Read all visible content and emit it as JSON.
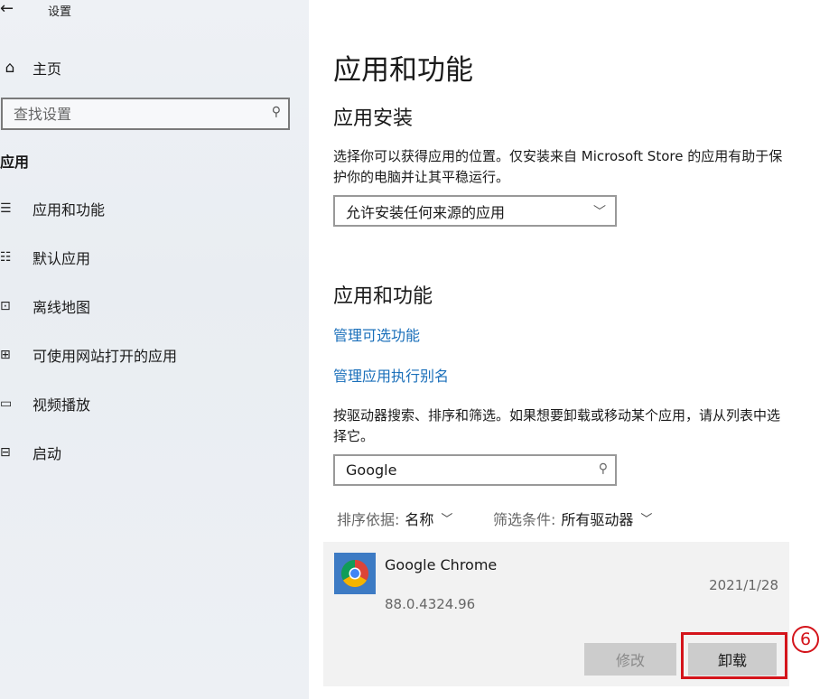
{
  "window": {
    "title": "设置",
    "back_glyph": "←"
  },
  "sidebar": {
    "home_label": "主页",
    "search_placeholder": "查找设置",
    "section_title": "应用",
    "items": [
      {
        "label": "应用和功能",
        "icon": "apps-features-icon",
        "glyph": "☰"
      },
      {
        "label": "默认应用",
        "icon": "default-apps-icon",
        "glyph": "☷"
      },
      {
        "label": "离线地图",
        "icon": "offline-maps-icon",
        "glyph": "⊡"
      },
      {
        "label": "可使用网站打开的应用",
        "icon": "apps-for-websites-icon",
        "glyph": "⊞"
      },
      {
        "label": "视频播放",
        "icon": "video-playback-icon",
        "glyph": "▭"
      },
      {
        "label": "启动",
        "icon": "startup-icon",
        "glyph": "⊟"
      }
    ]
  },
  "main": {
    "title": "应用和功能",
    "install_section": {
      "title": "应用安装",
      "description": "选择你可以获得应用的位置。仅安装来自 Microsoft Store 的应用有助于保护你的电脑并让其平稳运行。",
      "dropdown_value": "允许安装任何来源的应用"
    },
    "features_section": {
      "title": "应用和功能",
      "link_optional_features": "管理可选功能",
      "link_app_aliases": "管理应用执行别名",
      "description": "按驱动器搜索、排序和筛选。如果想要卸载或移动某个应用，请从列表中选择它。",
      "search_value": "Google",
      "sort_label": "排序依据:",
      "sort_value": "名称",
      "filter_label": "筛选条件:",
      "filter_value": "所有驱动器"
    },
    "app": {
      "name": "Google Chrome",
      "version": "88.0.4324.96",
      "date": "2021/1/28",
      "modify_label": "修改",
      "uninstall_label": "卸载"
    }
  },
  "annotation": {
    "step_number": "6",
    "color": "#d4141b"
  },
  "colors": {
    "link": "#1a6fba",
    "sidebar_bg": "#edf0f4",
    "card_bg": "#f2f2f2"
  }
}
